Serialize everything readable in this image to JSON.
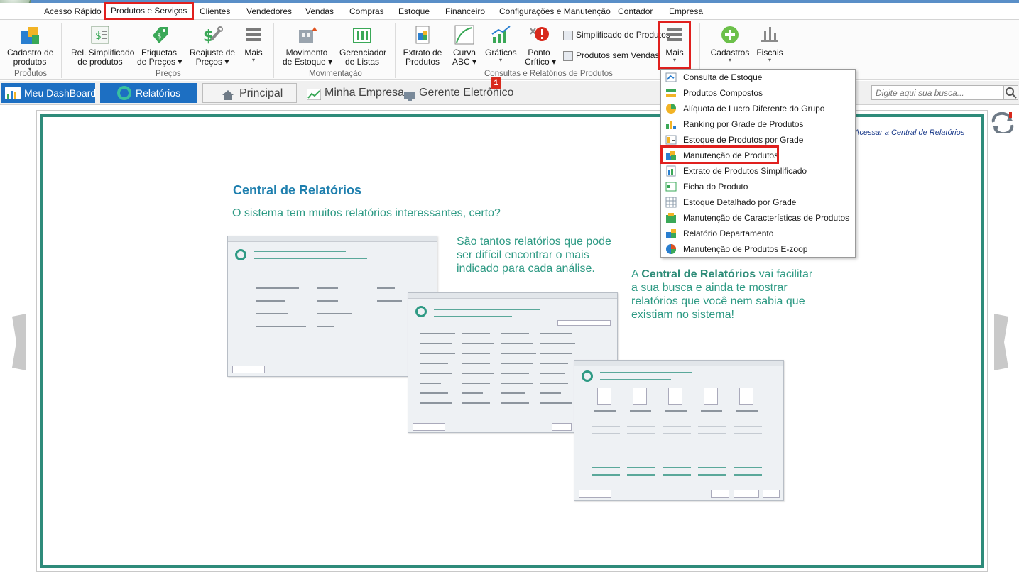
{
  "menubar": {
    "items": [
      {
        "label": "Acesso Rápido"
      },
      {
        "label": "Produtos e Serviços"
      },
      {
        "label": "Clientes"
      },
      {
        "label": "Vendedores"
      },
      {
        "label": "Vendas"
      },
      {
        "label": "Compras"
      },
      {
        "label": "Estoque"
      },
      {
        "label": "Financeiro"
      },
      {
        "label": "Configurações e Manutenção"
      },
      {
        "label": "Contador"
      },
      {
        "label": "Empresa"
      }
    ],
    "active_index": 1
  },
  "ribbon": {
    "cadastro_line1": "Cadastro de",
    "cadastro_line2": "produtos",
    "group_produtos": "Produtos",
    "rel_simpl_line1": "Rel. Simplificado",
    "rel_simpl_line2": "de produtos",
    "etiquetas_line1": "Etiquetas",
    "etiquetas_line2": "de Preços",
    "reajuste_line1": "Reajuste de",
    "reajuste_line2": "Preços",
    "mais1": "Mais",
    "group_precos": "Preços",
    "movimento_line1": "Movimento",
    "movimento_line2": "de Estoque",
    "gerenciador_line1": "Gerenciador",
    "gerenciador_line2": "de Listas",
    "group_movimentacao": "Movimentação",
    "extrato_line1": "Extrato de",
    "extrato_line2": "Produtos",
    "curva_line1": "Curva",
    "curva_line2": "ABC",
    "graficos": "Gráficos",
    "ponto_line1": "Ponto",
    "ponto_line2": "Crítico",
    "simplificado": "Simplificado de Produtos",
    "sem_vendas": "Produtos sem Vendas",
    "mais2": "Mais",
    "group_consultas": "Consultas e Relatórios de Produtos",
    "cadastros": "Cadastros",
    "fiscais": "Fiscais"
  },
  "tabs": {
    "dashboard": "Meu DashBoard",
    "relatorios": "Relatórios",
    "principal": "Principal",
    "minha_empresa": "Minha Empresa",
    "gerente": "Gerente Eletrônico",
    "badge": "1"
  },
  "search": {
    "placeholder": "Digite aqui sua busca..."
  },
  "content": {
    "link": "Acessar a Central de Relatórios",
    "title": "Central de Relatórios",
    "subtitle": "O sistema tem muitos relatórios interessantes, certo?",
    "p1": "São tantos relatórios que pode ser difícil encontrar o mais indicado para cada análise.",
    "p2_prefix": "A ",
    "p2_bold": "Central de Relatórios",
    "p2_rest": " vai facilitar a sua busca e ainda te mostrar relatórios que você nem sabia que existiam no sistema!"
  },
  "dropdown": {
    "items": [
      {
        "label": "Consulta de Estoque"
      },
      {
        "label": "Produtos Compostos"
      },
      {
        "label": "Alíquota de Lucro Diferente do Grupo"
      },
      {
        "label": "Ranking por Grade de Produtos"
      },
      {
        "label": "Estoque de Produtos por Grade"
      },
      {
        "label": "Manutenção de Produtos"
      },
      {
        "label": "Extrato de Produtos Simplificado"
      },
      {
        "label": "Ficha do Produto"
      },
      {
        "label": "Estoque Detalhado por Grade"
      },
      {
        "label": "Manutenção de Características de Produtos"
      },
      {
        "label": "Relatório Departamento"
      },
      {
        "label": "Manutenção de Produtos E-zoop"
      }
    ],
    "highlighted_index": 5
  },
  "colors": {
    "accent_blue": "#1d6fc2",
    "teal": "#2e8b7a",
    "highlight_red": "#e0201e"
  }
}
